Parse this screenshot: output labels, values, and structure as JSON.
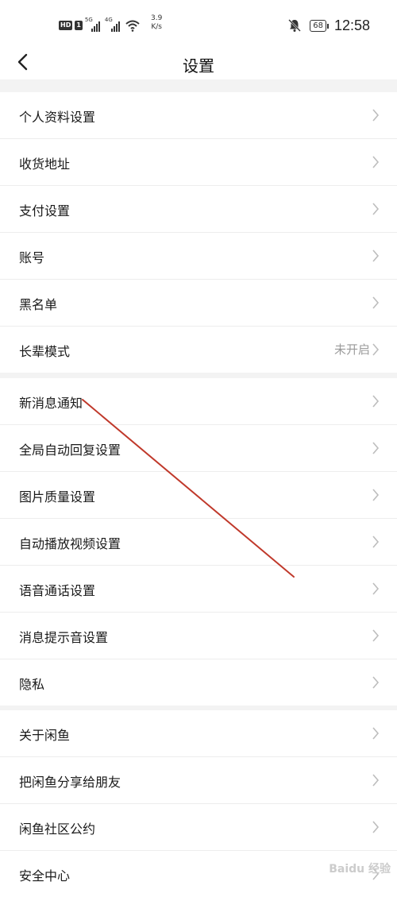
{
  "status_bar": {
    "hd_badge": "HD",
    "sim_badge": "1",
    "net1": "5G",
    "net2": "4G",
    "speed_value": "3.9",
    "speed_unit": "K/s",
    "battery": "68",
    "time": "12:58"
  },
  "header": {
    "title": "设置"
  },
  "groups": [
    [
      {
        "label": "个人资料设置"
      },
      {
        "label": "收货地址"
      },
      {
        "label": "支付设置"
      },
      {
        "label": "账号"
      },
      {
        "label": "黑名单"
      },
      {
        "label": "长辈模式",
        "value": "未开启"
      }
    ],
    [
      {
        "label": "新消息通知"
      },
      {
        "label": "全局自动回复设置"
      },
      {
        "label": "图片质量设置"
      },
      {
        "label": "自动播放视频设置"
      },
      {
        "label": "语音通话设置"
      },
      {
        "label": "消息提示音设置"
      },
      {
        "label": "隐私"
      }
    ],
    [
      {
        "label": "关于闲鱼"
      },
      {
        "label": "把闲鱼分享给朋友"
      },
      {
        "label": "闲鱼社区公约"
      },
      {
        "label": "安全中心"
      }
    ]
  ],
  "colors": {
    "annotation_arrow": "#c0392b",
    "chevron": "#bdbdbd",
    "background": "#f3f3f3"
  },
  "watermark": "Baidu 经验"
}
